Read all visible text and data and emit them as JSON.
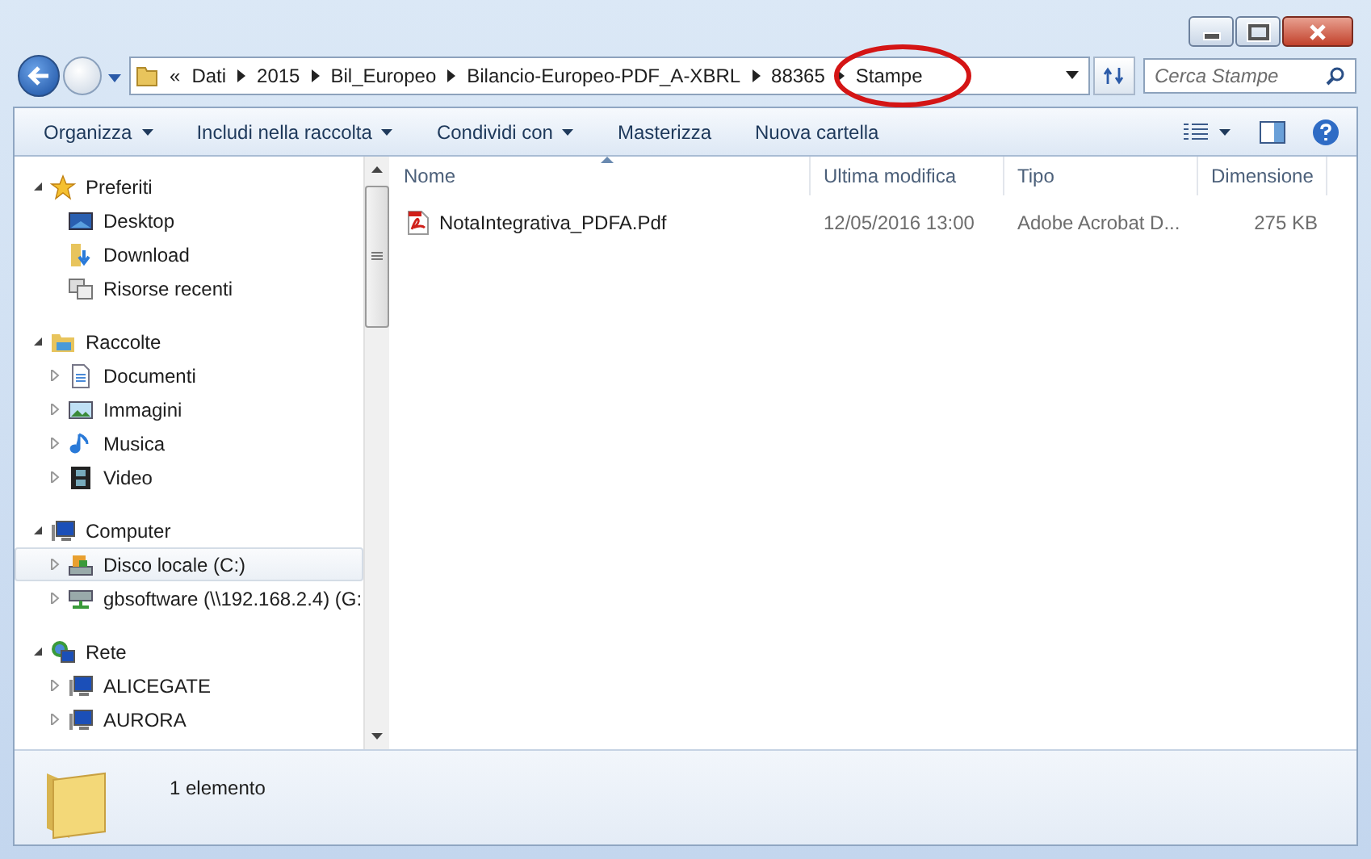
{
  "address_bar": {
    "overflow": "«",
    "crumbs": [
      "Dati",
      "2015",
      "Bil_Europeo",
      "Bilancio-Europeo-PDF_A-XBRL",
      "88365",
      "Stampe"
    ]
  },
  "search": {
    "placeholder": "Cerca Stampe"
  },
  "toolbar": {
    "items": [
      {
        "label": "Organizza",
        "dropdown": true
      },
      {
        "label": "Includi nella raccolta",
        "dropdown": true
      },
      {
        "label": "Condividi con",
        "dropdown": true
      },
      {
        "label": "Masterizza",
        "dropdown": false
      },
      {
        "label": "Nuova cartella",
        "dropdown": false
      }
    ]
  },
  "sidebar": {
    "groups": [
      {
        "label": "Preferiti",
        "kind": "star",
        "expanded": true,
        "selected": false,
        "children": [
          {
            "label": "Desktop",
            "kind": "desktop",
            "selected": false
          },
          {
            "label": "Download",
            "kind": "download",
            "selected": false
          },
          {
            "label": "Risorse recenti",
            "kind": "recent",
            "selected": false
          }
        ]
      },
      {
        "label": "Raccolte",
        "kind": "library",
        "expanded": true,
        "selected": false,
        "children": [
          {
            "label": "Documenti",
            "kind": "document",
            "expanded": false,
            "selected": false
          },
          {
            "label": "Immagini",
            "kind": "image",
            "expanded": false,
            "selected": false
          },
          {
            "label": "Musica",
            "kind": "music",
            "expanded": false,
            "selected": false
          },
          {
            "label": "Video",
            "kind": "video",
            "expanded": false,
            "selected": false
          }
        ]
      },
      {
        "label": "Computer",
        "kind": "computer",
        "expanded": true,
        "selected": false,
        "children": [
          {
            "label": "Disco locale (C:)",
            "kind": "drive",
            "expanded": false,
            "selected": true
          },
          {
            "label": "gbsoftware (\\\\192.168.2.4) (G:",
            "kind": "netdrive",
            "expanded": false,
            "selected": false
          }
        ]
      },
      {
        "label": "Rete",
        "kind": "network",
        "expanded": true,
        "selected": false,
        "children": [
          {
            "label": "ALICEGATE",
            "kind": "computer",
            "expanded": false,
            "selected": false
          },
          {
            "label": "AURORA",
            "kind": "computer",
            "expanded": false,
            "selected": false
          }
        ]
      }
    ]
  },
  "file_list": {
    "columns": [
      {
        "label": "Nome",
        "sorted": true
      },
      {
        "label": "Ultima modifica",
        "sorted": false
      },
      {
        "label": "Tipo",
        "sorted": false
      },
      {
        "label": "Dimensione",
        "sorted": false
      }
    ],
    "rows": [
      {
        "kind": "pdf",
        "name": "NotaIntegrativa_PDFA.Pdf",
        "modified": "12/05/2016 13:00",
        "type": "Adobe Acrobat D...",
        "size": "275 KB"
      }
    ]
  },
  "status_bar": {
    "count": "1 elemento"
  }
}
